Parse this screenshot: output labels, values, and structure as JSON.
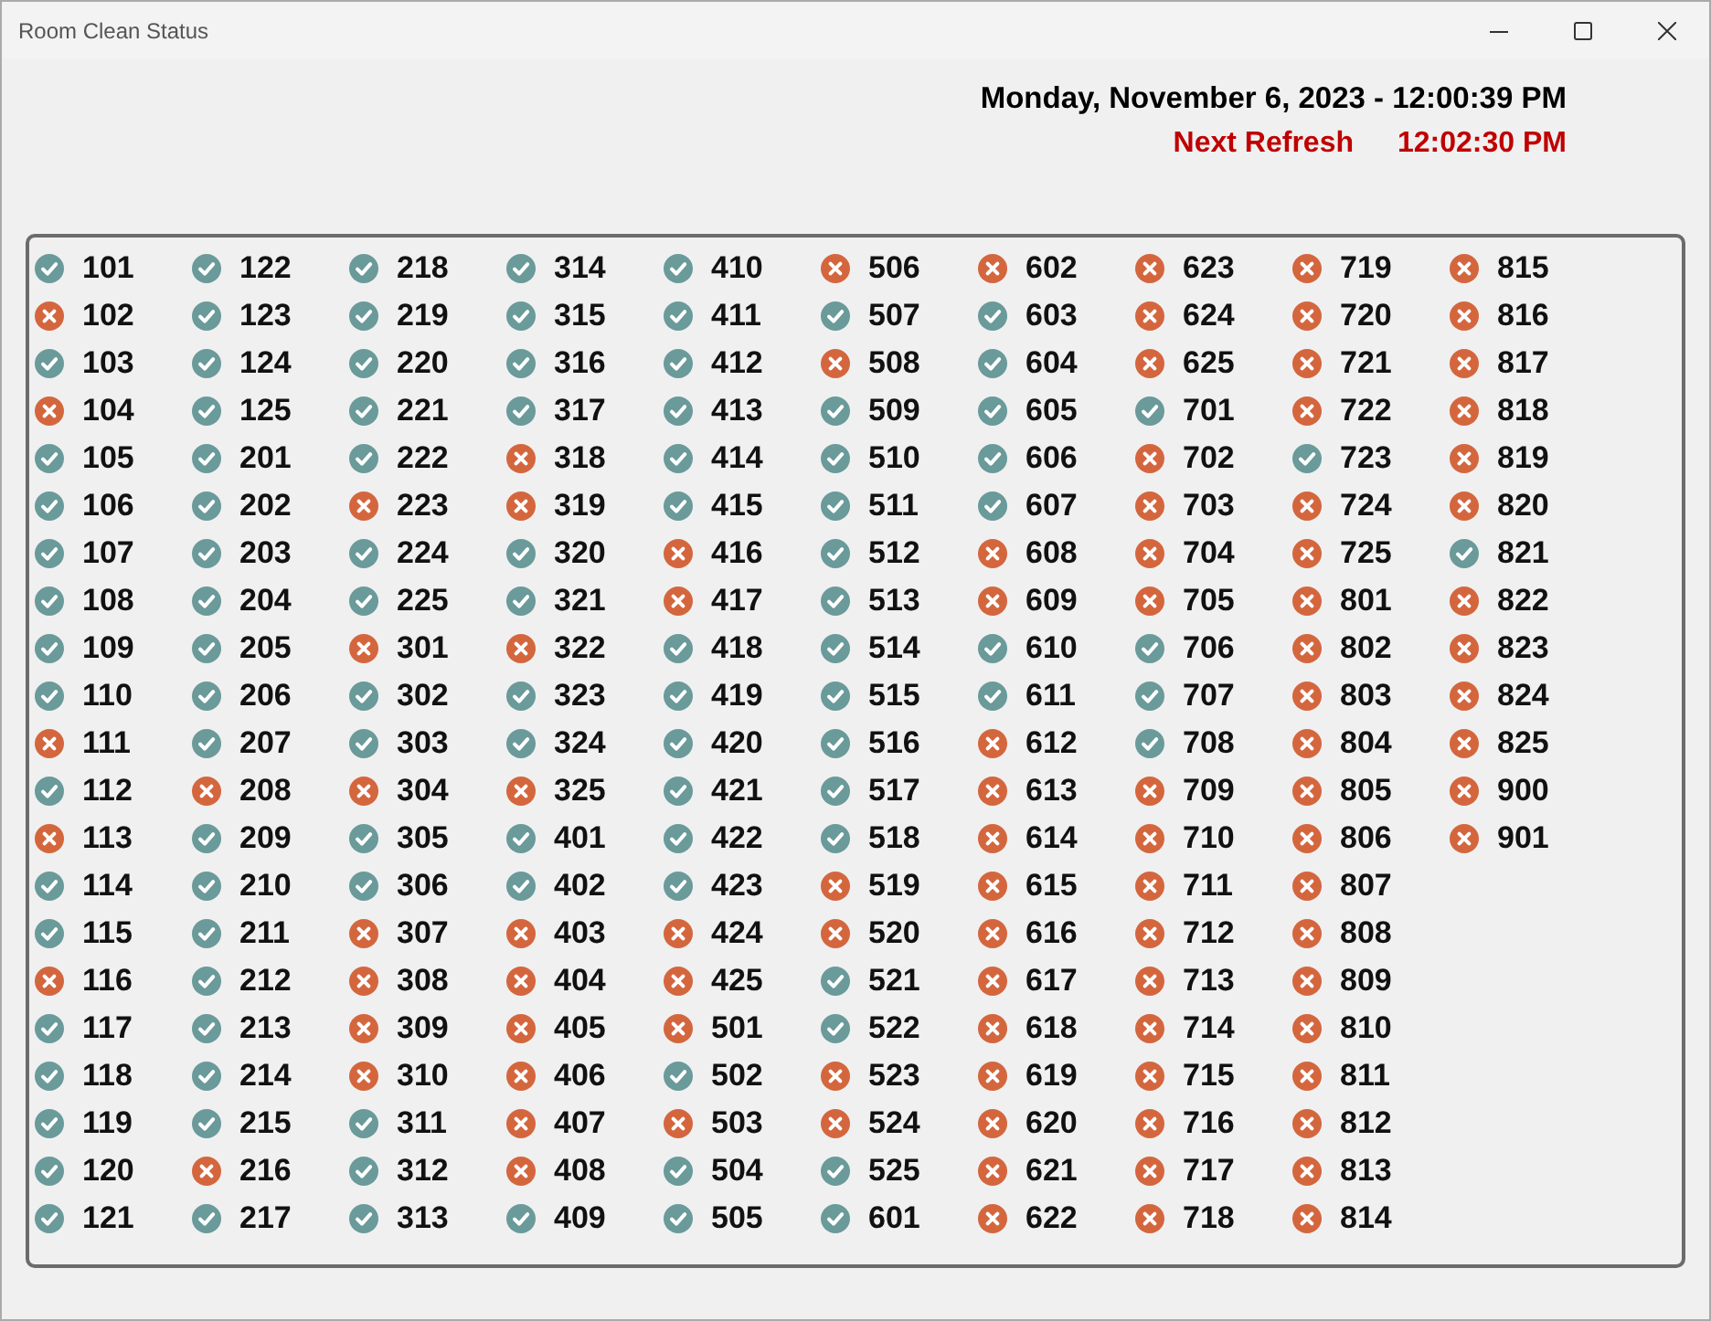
{
  "window": {
    "title": "Room Clean Status"
  },
  "clock": {
    "datetime": "Monday, November 6, 2023 - 12:00:39 PM",
    "next_refresh_label": "Next Refresh",
    "next_refresh_time": "12:02:30 PM"
  },
  "rooms": [
    {
      "room": "101",
      "clean": true
    },
    {
      "room": "102",
      "clean": false
    },
    {
      "room": "103",
      "clean": true
    },
    {
      "room": "104",
      "clean": false
    },
    {
      "room": "105",
      "clean": true
    },
    {
      "room": "106",
      "clean": true
    },
    {
      "room": "107",
      "clean": true
    },
    {
      "room": "108",
      "clean": true
    },
    {
      "room": "109",
      "clean": true
    },
    {
      "room": "110",
      "clean": true
    },
    {
      "room": "111",
      "clean": false
    },
    {
      "room": "112",
      "clean": true
    },
    {
      "room": "113",
      "clean": false
    },
    {
      "room": "114",
      "clean": true
    },
    {
      "room": "115",
      "clean": true
    },
    {
      "room": "116",
      "clean": false
    },
    {
      "room": "117",
      "clean": true
    },
    {
      "room": "118",
      "clean": true
    },
    {
      "room": "119",
      "clean": true
    },
    {
      "room": "120",
      "clean": true
    },
    {
      "room": "121",
      "clean": true
    },
    {
      "room": "122",
      "clean": true
    },
    {
      "room": "123",
      "clean": true
    },
    {
      "room": "124",
      "clean": true
    },
    {
      "room": "125",
      "clean": true
    },
    {
      "room": "201",
      "clean": true
    },
    {
      "room": "202",
      "clean": true
    },
    {
      "room": "203",
      "clean": true
    },
    {
      "room": "204",
      "clean": true
    },
    {
      "room": "205",
      "clean": true
    },
    {
      "room": "206",
      "clean": true
    },
    {
      "room": "207",
      "clean": true
    },
    {
      "room": "208",
      "clean": false
    },
    {
      "room": "209",
      "clean": true
    },
    {
      "room": "210",
      "clean": true
    },
    {
      "room": "211",
      "clean": true
    },
    {
      "room": "212",
      "clean": true
    },
    {
      "room": "213",
      "clean": true
    },
    {
      "room": "214",
      "clean": true
    },
    {
      "room": "215",
      "clean": true
    },
    {
      "room": "216",
      "clean": false
    },
    {
      "room": "217",
      "clean": true
    },
    {
      "room": "218",
      "clean": true
    },
    {
      "room": "219",
      "clean": true
    },
    {
      "room": "220",
      "clean": true
    },
    {
      "room": "221",
      "clean": true
    },
    {
      "room": "222",
      "clean": true
    },
    {
      "room": "223",
      "clean": false
    },
    {
      "room": "224",
      "clean": true
    },
    {
      "room": "225",
      "clean": true
    },
    {
      "room": "301",
      "clean": false
    },
    {
      "room": "302",
      "clean": true
    },
    {
      "room": "303",
      "clean": true
    },
    {
      "room": "304",
      "clean": false
    },
    {
      "room": "305",
      "clean": true
    },
    {
      "room": "306",
      "clean": true
    },
    {
      "room": "307",
      "clean": false
    },
    {
      "room": "308",
      "clean": false
    },
    {
      "room": "309",
      "clean": false
    },
    {
      "room": "310",
      "clean": false
    },
    {
      "room": "311",
      "clean": true
    },
    {
      "room": "312",
      "clean": true
    },
    {
      "room": "313",
      "clean": true
    },
    {
      "room": "314",
      "clean": true
    },
    {
      "room": "315",
      "clean": true
    },
    {
      "room": "316",
      "clean": true
    },
    {
      "room": "317",
      "clean": true
    },
    {
      "room": "318",
      "clean": false
    },
    {
      "room": "319",
      "clean": false
    },
    {
      "room": "320",
      "clean": true
    },
    {
      "room": "321",
      "clean": true
    },
    {
      "room": "322",
      "clean": false
    },
    {
      "room": "323",
      "clean": true
    },
    {
      "room": "324",
      "clean": true
    },
    {
      "room": "325",
      "clean": false
    },
    {
      "room": "401",
      "clean": true
    },
    {
      "room": "402",
      "clean": true
    },
    {
      "room": "403",
      "clean": false
    },
    {
      "room": "404",
      "clean": false
    },
    {
      "room": "405",
      "clean": false
    },
    {
      "room": "406",
      "clean": false
    },
    {
      "room": "407",
      "clean": false
    },
    {
      "room": "408",
      "clean": false
    },
    {
      "room": "409",
      "clean": true
    },
    {
      "room": "410",
      "clean": true
    },
    {
      "room": "411",
      "clean": true
    },
    {
      "room": "412",
      "clean": true
    },
    {
      "room": "413",
      "clean": true
    },
    {
      "room": "414",
      "clean": true
    },
    {
      "room": "415",
      "clean": true
    },
    {
      "room": "416",
      "clean": false
    },
    {
      "room": "417",
      "clean": false
    },
    {
      "room": "418",
      "clean": true
    },
    {
      "room": "419",
      "clean": true
    },
    {
      "room": "420",
      "clean": true
    },
    {
      "room": "421",
      "clean": true
    },
    {
      "room": "422",
      "clean": true
    },
    {
      "room": "423",
      "clean": true
    },
    {
      "room": "424",
      "clean": false
    },
    {
      "room": "425",
      "clean": false
    },
    {
      "room": "501",
      "clean": false
    },
    {
      "room": "502",
      "clean": true
    },
    {
      "room": "503",
      "clean": false
    },
    {
      "room": "504",
      "clean": true
    },
    {
      "room": "505",
      "clean": true
    },
    {
      "room": "506",
      "clean": false
    },
    {
      "room": "507",
      "clean": true
    },
    {
      "room": "508",
      "clean": false
    },
    {
      "room": "509",
      "clean": true
    },
    {
      "room": "510",
      "clean": true
    },
    {
      "room": "511",
      "clean": true
    },
    {
      "room": "512",
      "clean": true
    },
    {
      "room": "513",
      "clean": true
    },
    {
      "room": "514",
      "clean": true
    },
    {
      "room": "515",
      "clean": true
    },
    {
      "room": "516",
      "clean": true
    },
    {
      "room": "517",
      "clean": true
    },
    {
      "room": "518",
      "clean": true
    },
    {
      "room": "519",
      "clean": false
    },
    {
      "room": "520",
      "clean": false
    },
    {
      "room": "521",
      "clean": true
    },
    {
      "room": "522",
      "clean": true
    },
    {
      "room": "523",
      "clean": false
    },
    {
      "room": "524",
      "clean": false
    },
    {
      "room": "525",
      "clean": true
    },
    {
      "room": "601",
      "clean": true
    },
    {
      "room": "602",
      "clean": false
    },
    {
      "room": "603",
      "clean": true
    },
    {
      "room": "604",
      "clean": true
    },
    {
      "room": "605",
      "clean": true
    },
    {
      "room": "606",
      "clean": true
    },
    {
      "room": "607",
      "clean": true
    },
    {
      "room": "608",
      "clean": false
    },
    {
      "room": "609",
      "clean": false
    },
    {
      "room": "610",
      "clean": true
    },
    {
      "room": "611",
      "clean": true
    },
    {
      "room": "612",
      "clean": false
    },
    {
      "room": "613",
      "clean": false
    },
    {
      "room": "614",
      "clean": false
    },
    {
      "room": "615",
      "clean": false
    },
    {
      "room": "616",
      "clean": false
    },
    {
      "room": "617",
      "clean": false
    },
    {
      "room": "618",
      "clean": false
    },
    {
      "room": "619",
      "clean": false
    },
    {
      "room": "620",
      "clean": false
    },
    {
      "room": "621",
      "clean": false
    },
    {
      "room": "622",
      "clean": false
    },
    {
      "room": "623",
      "clean": false
    },
    {
      "room": "624",
      "clean": false
    },
    {
      "room": "625",
      "clean": false
    },
    {
      "room": "701",
      "clean": true
    },
    {
      "room": "702",
      "clean": false
    },
    {
      "room": "703",
      "clean": false
    },
    {
      "room": "704",
      "clean": false
    },
    {
      "room": "705",
      "clean": false
    },
    {
      "room": "706",
      "clean": true
    },
    {
      "room": "707",
      "clean": true
    },
    {
      "room": "708",
      "clean": true
    },
    {
      "room": "709",
      "clean": false
    },
    {
      "room": "710",
      "clean": false
    },
    {
      "room": "711",
      "clean": false
    },
    {
      "room": "712",
      "clean": false
    },
    {
      "room": "713",
      "clean": false
    },
    {
      "room": "714",
      "clean": false
    },
    {
      "room": "715",
      "clean": false
    },
    {
      "room": "716",
      "clean": false
    },
    {
      "room": "717",
      "clean": false
    },
    {
      "room": "718",
      "clean": false
    },
    {
      "room": "719",
      "clean": false
    },
    {
      "room": "720",
      "clean": false
    },
    {
      "room": "721",
      "clean": false
    },
    {
      "room": "722",
      "clean": false
    },
    {
      "room": "723",
      "clean": true
    },
    {
      "room": "724",
      "clean": false
    },
    {
      "room": "725",
      "clean": false
    },
    {
      "room": "801",
      "clean": false
    },
    {
      "room": "802",
      "clean": false
    },
    {
      "room": "803",
      "clean": false
    },
    {
      "room": "804",
      "clean": false
    },
    {
      "room": "805",
      "clean": false
    },
    {
      "room": "806",
      "clean": false
    },
    {
      "room": "807",
      "clean": false
    },
    {
      "room": "808",
      "clean": false
    },
    {
      "room": "809",
      "clean": false
    },
    {
      "room": "810",
      "clean": false
    },
    {
      "room": "811",
      "clean": false
    },
    {
      "room": "812",
      "clean": false
    },
    {
      "room": "813",
      "clean": false
    },
    {
      "room": "814",
      "clean": false
    },
    {
      "room": "815",
      "clean": false
    },
    {
      "room": "816",
      "clean": false
    },
    {
      "room": "817",
      "clean": false
    },
    {
      "room": "818",
      "clean": false
    },
    {
      "room": "819",
      "clean": false
    },
    {
      "room": "820",
      "clean": false
    },
    {
      "room": "821",
      "clean": true
    },
    {
      "room": "822",
      "clean": false
    },
    {
      "room": "823",
      "clean": false
    },
    {
      "room": "824",
      "clean": false
    },
    {
      "room": "825",
      "clean": false
    },
    {
      "room": "900",
      "clean": false
    },
    {
      "room": "901",
      "clean": false
    }
  ]
}
